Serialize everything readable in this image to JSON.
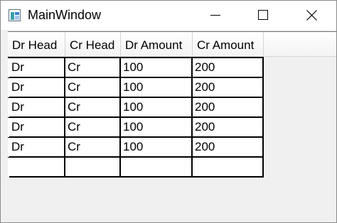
{
  "window": {
    "title": "MainWindow",
    "icons": {
      "app": "app-window-icon",
      "minimize": "minimize-icon",
      "maximize": "maximize-icon",
      "close": "close-icon"
    }
  },
  "grid": {
    "columns": [
      "Dr Head",
      "Cr Head",
      "Dr Amount",
      "Cr Amount"
    ],
    "rows": [
      [
        "Dr",
        "Cr",
        "100",
        "200"
      ],
      [
        "Dr",
        "Cr",
        "100",
        "200"
      ],
      [
        "Dr",
        "Cr",
        "100",
        "200"
      ],
      [
        "Dr",
        "Cr",
        "100",
        "200"
      ],
      [
        "Dr",
        "Cr",
        "100",
        "200"
      ],
      [
        "",
        "",
        "",
        ""
      ]
    ]
  }
}
